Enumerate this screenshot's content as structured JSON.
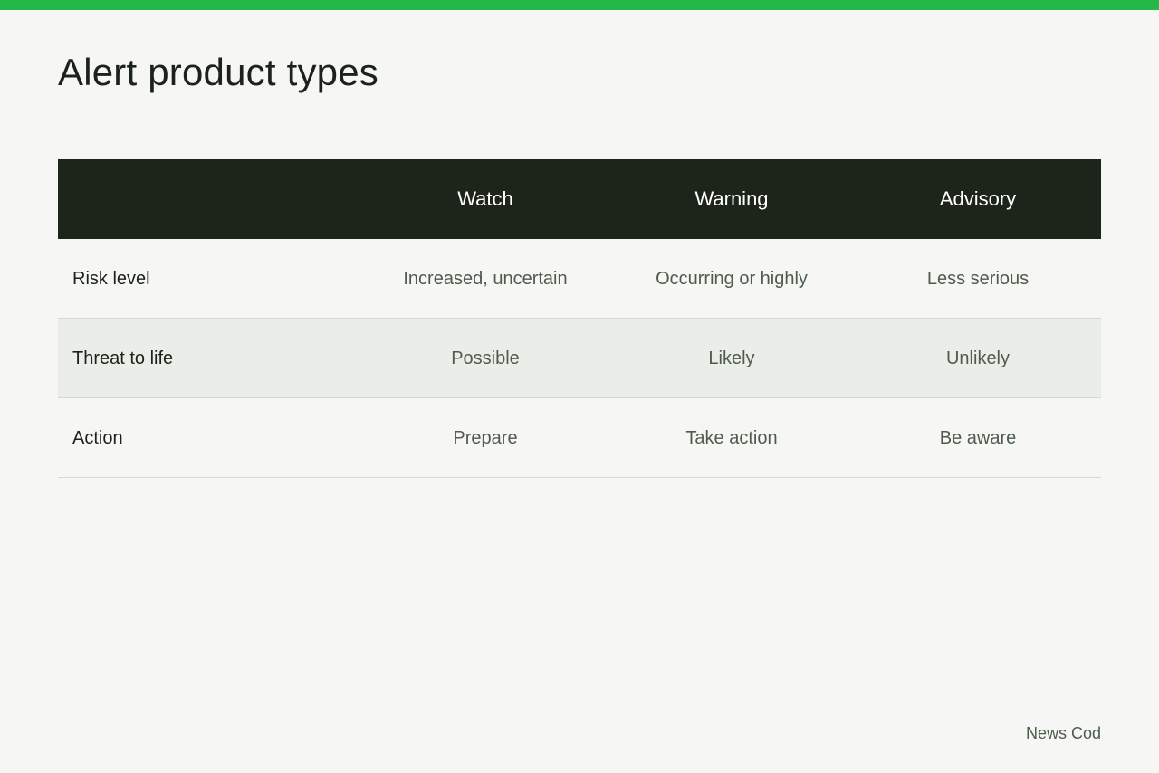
{
  "title": "Alert product types",
  "table": {
    "columns": [
      "",
      "Watch",
      "Warning",
      "Advisory"
    ],
    "rows": [
      {
        "label": "Risk level",
        "values": [
          "Increased, uncertain",
          "Occurring or highly",
          "Less serious"
        ]
      },
      {
        "label": "Threat to life",
        "values": [
          "Possible",
          "Likely",
          "Unlikely"
        ]
      },
      {
        "label": "Action",
        "values": [
          "Prepare",
          "Take action",
          "Be aware"
        ]
      }
    ]
  },
  "source": "News Cod",
  "colors": {
    "accent": "#23b847",
    "header_bg": "#1d2419",
    "background": "#f6f7f4",
    "alt_row": "#ebede8"
  }
}
